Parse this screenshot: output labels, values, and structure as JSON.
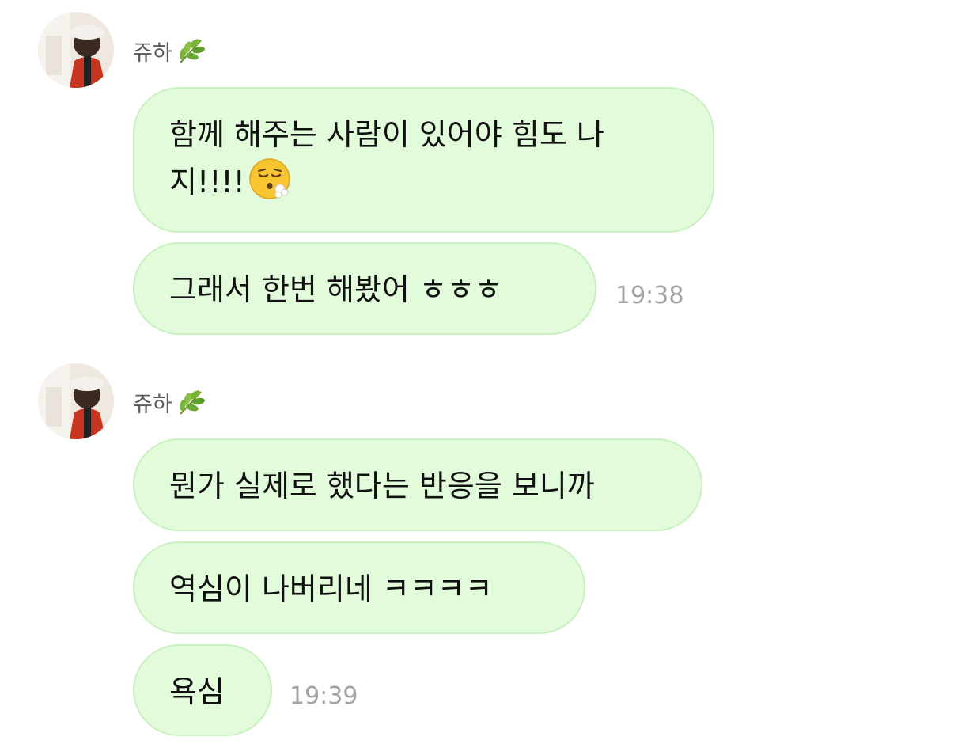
{
  "groups": [
    {
      "sender": {
        "name": "쥬하",
        "emoji_icon": "herb-leaf-icon"
      },
      "messages": [
        {
          "lines": [
            "함께 해주는 사람이 있어야 힘도 나",
            "지!!!!"
          ],
          "trailing_emoji": "face-exhaling-icon"
        },
        {
          "lines": [
            "그래서 한번 해봤어 ㅎㅎㅎ"
          ],
          "time": "19:38"
        }
      ]
    },
    {
      "sender": {
        "name": "쥬하",
        "emoji_icon": "herb-leaf-icon"
      },
      "messages": [
        {
          "lines": [
            "뭔가 실제로 했다는 반응을 보니까"
          ]
        },
        {
          "lines": [
            "역심이 나버리네 ㅋㅋㅋㅋ"
          ]
        },
        {
          "lines": [
            "욕심"
          ],
          "time": "19:39"
        }
      ]
    }
  ],
  "colors": {
    "bubble_bg": "#e1fbdb",
    "bubble_border": "#c9f0c1",
    "text": "#111111",
    "sender_text": "#5b5b5b",
    "time_text": "#a3a3a3"
  }
}
